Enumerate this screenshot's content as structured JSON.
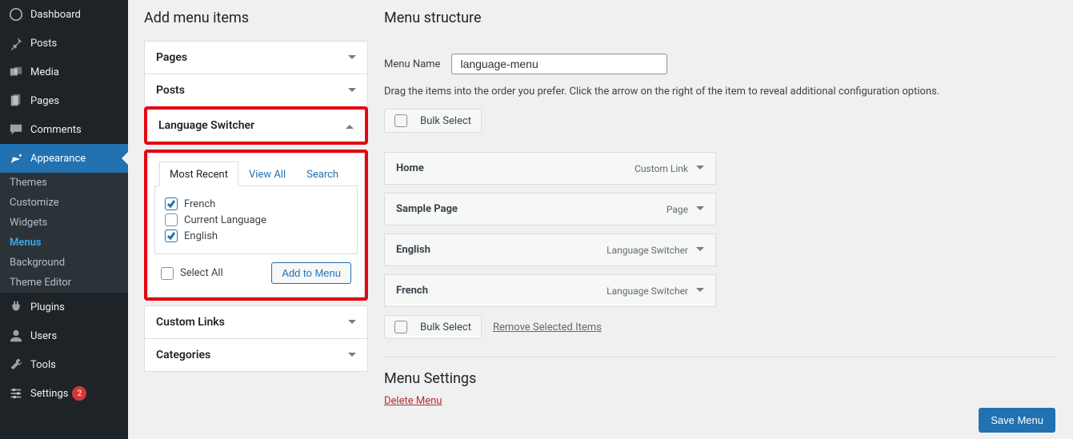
{
  "sidebar": {
    "items": [
      {
        "label": "Dashboard"
      },
      {
        "label": "Posts"
      },
      {
        "label": "Media"
      },
      {
        "label": "Pages"
      },
      {
        "label": "Comments"
      },
      {
        "label": "Appearance"
      },
      {
        "label": "Plugins"
      },
      {
        "label": "Users"
      },
      {
        "label": "Tools"
      },
      {
        "label": "Settings",
        "badge": "2"
      }
    ],
    "appearance_sub": [
      {
        "label": "Themes"
      },
      {
        "label": "Customize"
      },
      {
        "label": "Widgets"
      },
      {
        "label": "Menus"
      },
      {
        "label": "Background"
      },
      {
        "label": "Theme Editor"
      }
    ]
  },
  "left": {
    "title": "Add menu items",
    "panels": {
      "pages": "Pages",
      "posts": "Posts",
      "lang": "Language Switcher",
      "custom": "Custom Links",
      "cats": "Categories"
    },
    "tabs": {
      "recent": "Most Recent",
      "viewall": "View All",
      "search": "Search"
    },
    "langs": [
      {
        "label": "French",
        "checked": true
      },
      {
        "label": "Current Language",
        "checked": false
      },
      {
        "label": "English",
        "checked": true
      }
    ],
    "selectall": "Select All",
    "addbtn": "Add to Menu"
  },
  "right": {
    "title": "Menu structure",
    "name_label": "Menu Name",
    "name_value": "language-menu",
    "desc": "Drag the items into the order you prefer. Click the arrow on the right of the item to reveal additional configuration options.",
    "bulk": "Bulk Select",
    "items": [
      {
        "label": "Home",
        "type": "Custom Link"
      },
      {
        "label": "Sample Page",
        "type": "Page"
      },
      {
        "label": "English",
        "type": "Language Switcher"
      },
      {
        "label": "French",
        "type": "Language Switcher"
      }
    ],
    "remove": "Remove Selected Items",
    "settings": "Menu Settings",
    "delete": "Delete Menu",
    "save": "Save Menu"
  }
}
